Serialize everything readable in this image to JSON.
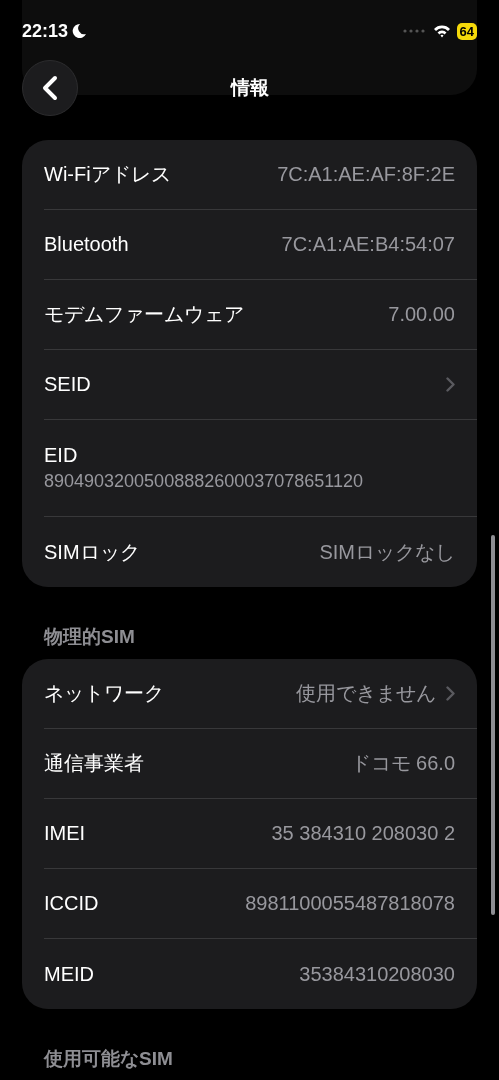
{
  "status_bar": {
    "time": "22:13",
    "focus_moon": true,
    "battery": "64"
  },
  "nav": {
    "title": "情報"
  },
  "groups": [
    {
      "rows": [
        {
          "kind": "detail",
          "label": "Wi-Fiアドレス",
          "value": "7C:A1:AE:AF:8F:2E"
        },
        {
          "kind": "detail",
          "label": "Bluetooth",
          "value": "7C:A1:AE:B4:54:07"
        },
        {
          "kind": "detail",
          "label": "モデムファームウェア",
          "value": "7.00.00"
        },
        {
          "kind": "link",
          "label": "SEID"
        },
        {
          "kind": "stacked",
          "label": "EID",
          "value": "89049032005008882600037078651120"
        },
        {
          "kind": "detail",
          "label": "SIMロック",
          "value": "SIMロックなし"
        }
      ]
    },
    {
      "header": "物理的SIM",
      "rows": [
        {
          "kind": "link",
          "label": "ネットワーク",
          "value": "使用できません"
        },
        {
          "kind": "detail",
          "label": "通信事業者",
          "value": "ドコモ 66.0"
        },
        {
          "kind": "detail",
          "label": "IMEI",
          "value": "35 384310 208030 2"
        },
        {
          "kind": "detail",
          "label": "ICCID",
          "value": "8981100055487818078"
        },
        {
          "kind": "detail",
          "label": "MEID",
          "value": "35384310208030"
        }
      ]
    },
    {
      "header": "使用可能なSIM"
    }
  ]
}
